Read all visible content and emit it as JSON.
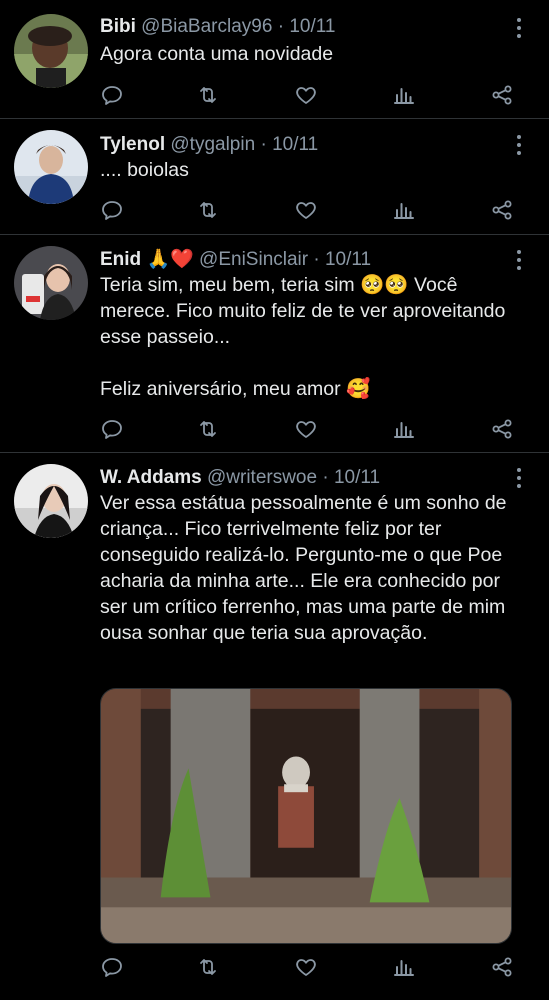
{
  "tweets": [
    {
      "name": "Bibi",
      "handle": "@BiaBarclay96",
      "separator": "·",
      "date": "10/11",
      "text": "Agora conta uma novidade",
      "avatar_icon": "avatar-bibi"
    },
    {
      "name": "Tylenol",
      "handle": "@tygalpin",
      "separator": "·",
      "date": "10/11",
      "text": ".... boiolas",
      "avatar_icon": "avatar-tylenol"
    },
    {
      "name": "Enid 🙏❤️",
      "handle": "@EniSinclair",
      "separator": "·",
      "date": "10/11",
      "text": "Teria sim, meu bem, teria sim 🥺🥺 Você merece. Fico muito feliz de te ver aproveitando esse passeio...\n\nFeliz aniversário, meu amor 🥰",
      "avatar_icon": "avatar-enid"
    },
    {
      "name": "W. Addams",
      "handle": "@writerswoe",
      "separator": "·",
      "date": "10/11",
      "text": "Ver essa estátua pessoalmente é um sonho de criança... Fico terrivelmente feliz por ter conseguido realizá-lo. Pergunto-me o que Poe acharia da minha arte... Ele era conhecido por ser um crítico ferrenho, mas uma parte de mim ousa sonhar que teria sua aprovação.",
      "avatar_icon": "avatar-waddams",
      "media": "photo-brick-arches-statue"
    }
  ],
  "action_icons": [
    "reply-icon",
    "retweet-icon",
    "like-icon",
    "views-icon",
    "share-icon"
  ],
  "colors": {
    "background": "#000000",
    "text": "#e7e9ea",
    "muted": "#8b98a5",
    "divider": "#2f3336"
  }
}
